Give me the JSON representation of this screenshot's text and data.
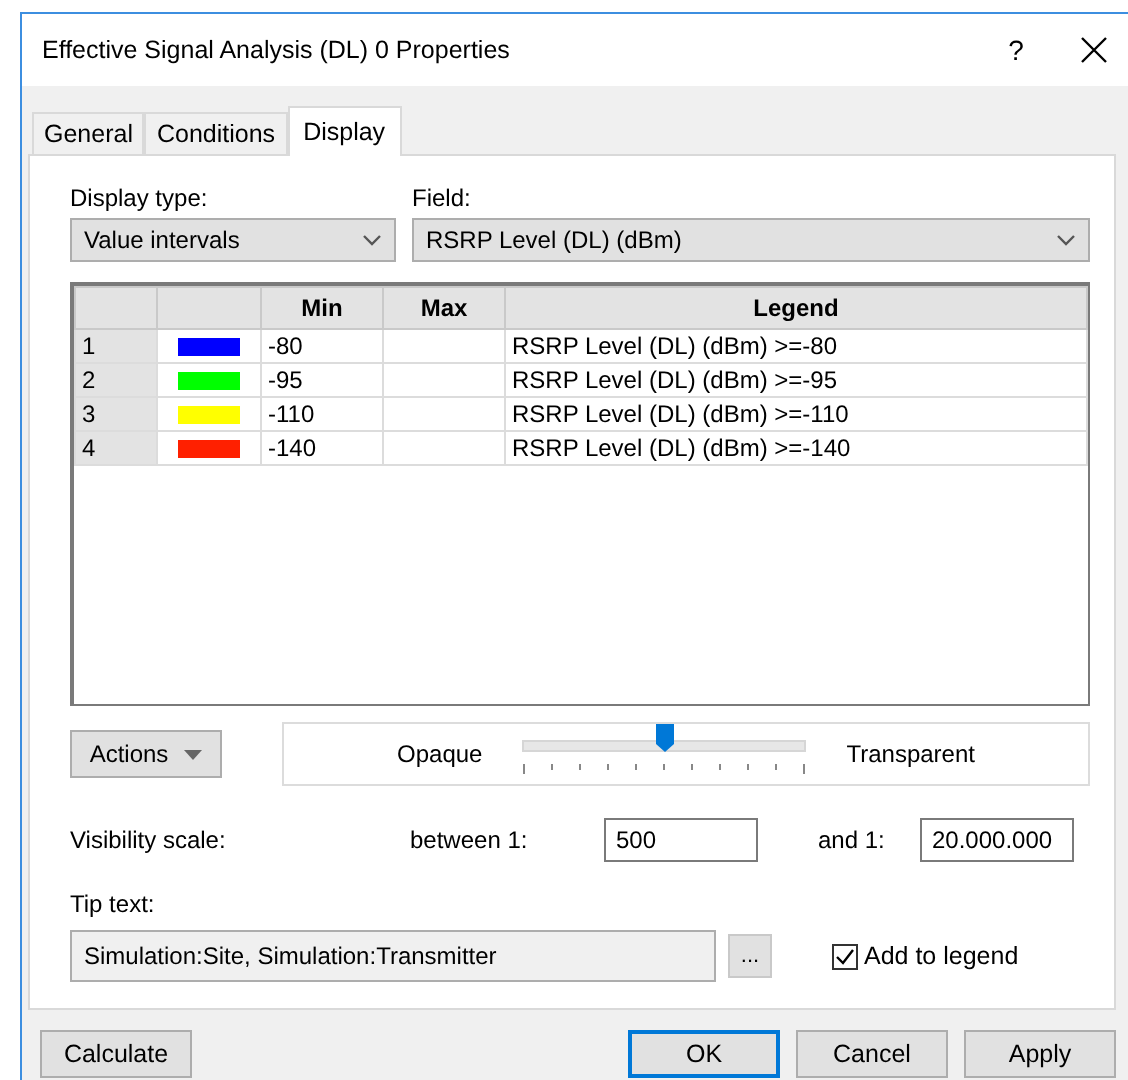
{
  "window": {
    "title": "Effective Signal Analysis (DL) 0 Properties",
    "help": "?"
  },
  "tabs": [
    {
      "label": "General",
      "selected": false
    },
    {
      "label": "Conditions",
      "selected": false
    },
    {
      "label": "Display",
      "selected": true
    }
  ],
  "display_type": {
    "label": "Display type:",
    "value": "Value intervals"
  },
  "field": {
    "label": "Field:",
    "value": "RSRP Level (DL) (dBm)"
  },
  "table": {
    "columns": [
      "Min",
      "Max",
      "Legend"
    ],
    "rows": [
      {
        "index": "1",
        "color": "#0000ff",
        "min": "-80",
        "legend": "RSRP Level (DL) (dBm) >=-80"
      },
      {
        "index": "2",
        "color": "#00ff00",
        "min": "-95",
        "legend": "RSRP Level (DL) (dBm) >=-95"
      },
      {
        "index": "3",
        "color": "#ffff00",
        "min": "-110",
        "legend": "RSRP Level (DL) (dBm) >=-110"
      },
      {
        "index": "4",
        "color": "#ff2000",
        "min": "-140",
        "legend": "RSRP Level (DL) (dBm) >=-140"
      }
    ]
  },
  "actions_button": "Actions",
  "transparency": {
    "left_label": "Opaque",
    "right_label": "Transparent",
    "level": 0.5
  },
  "visibility": {
    "label": "Visibility scale:",
    "between_label": "between 1:",
    "between_value": "500",
    "and_label": "and 1:",
    "and_value": "20.000.000"
  },
  "tip_text": {
    "label": "Tip text:",
    "value": "Simulation:Site, Simulation:Transmitter",
    "browse": "...",
    "add_to_legend": {
      "label": "Add to legend",
      "checked": true
    }
  },
  "left_buttons": [
    {
      "label": "Calculate",
      "default": false
    }
  ],
  "right_buttons": [
    {
      "label": "OK",
      "default": true
    },
    {
      "label": "Cancel",
      "default": false
    },
    {
      "label": "Apply",
      "default": false
    }
  ]
}
